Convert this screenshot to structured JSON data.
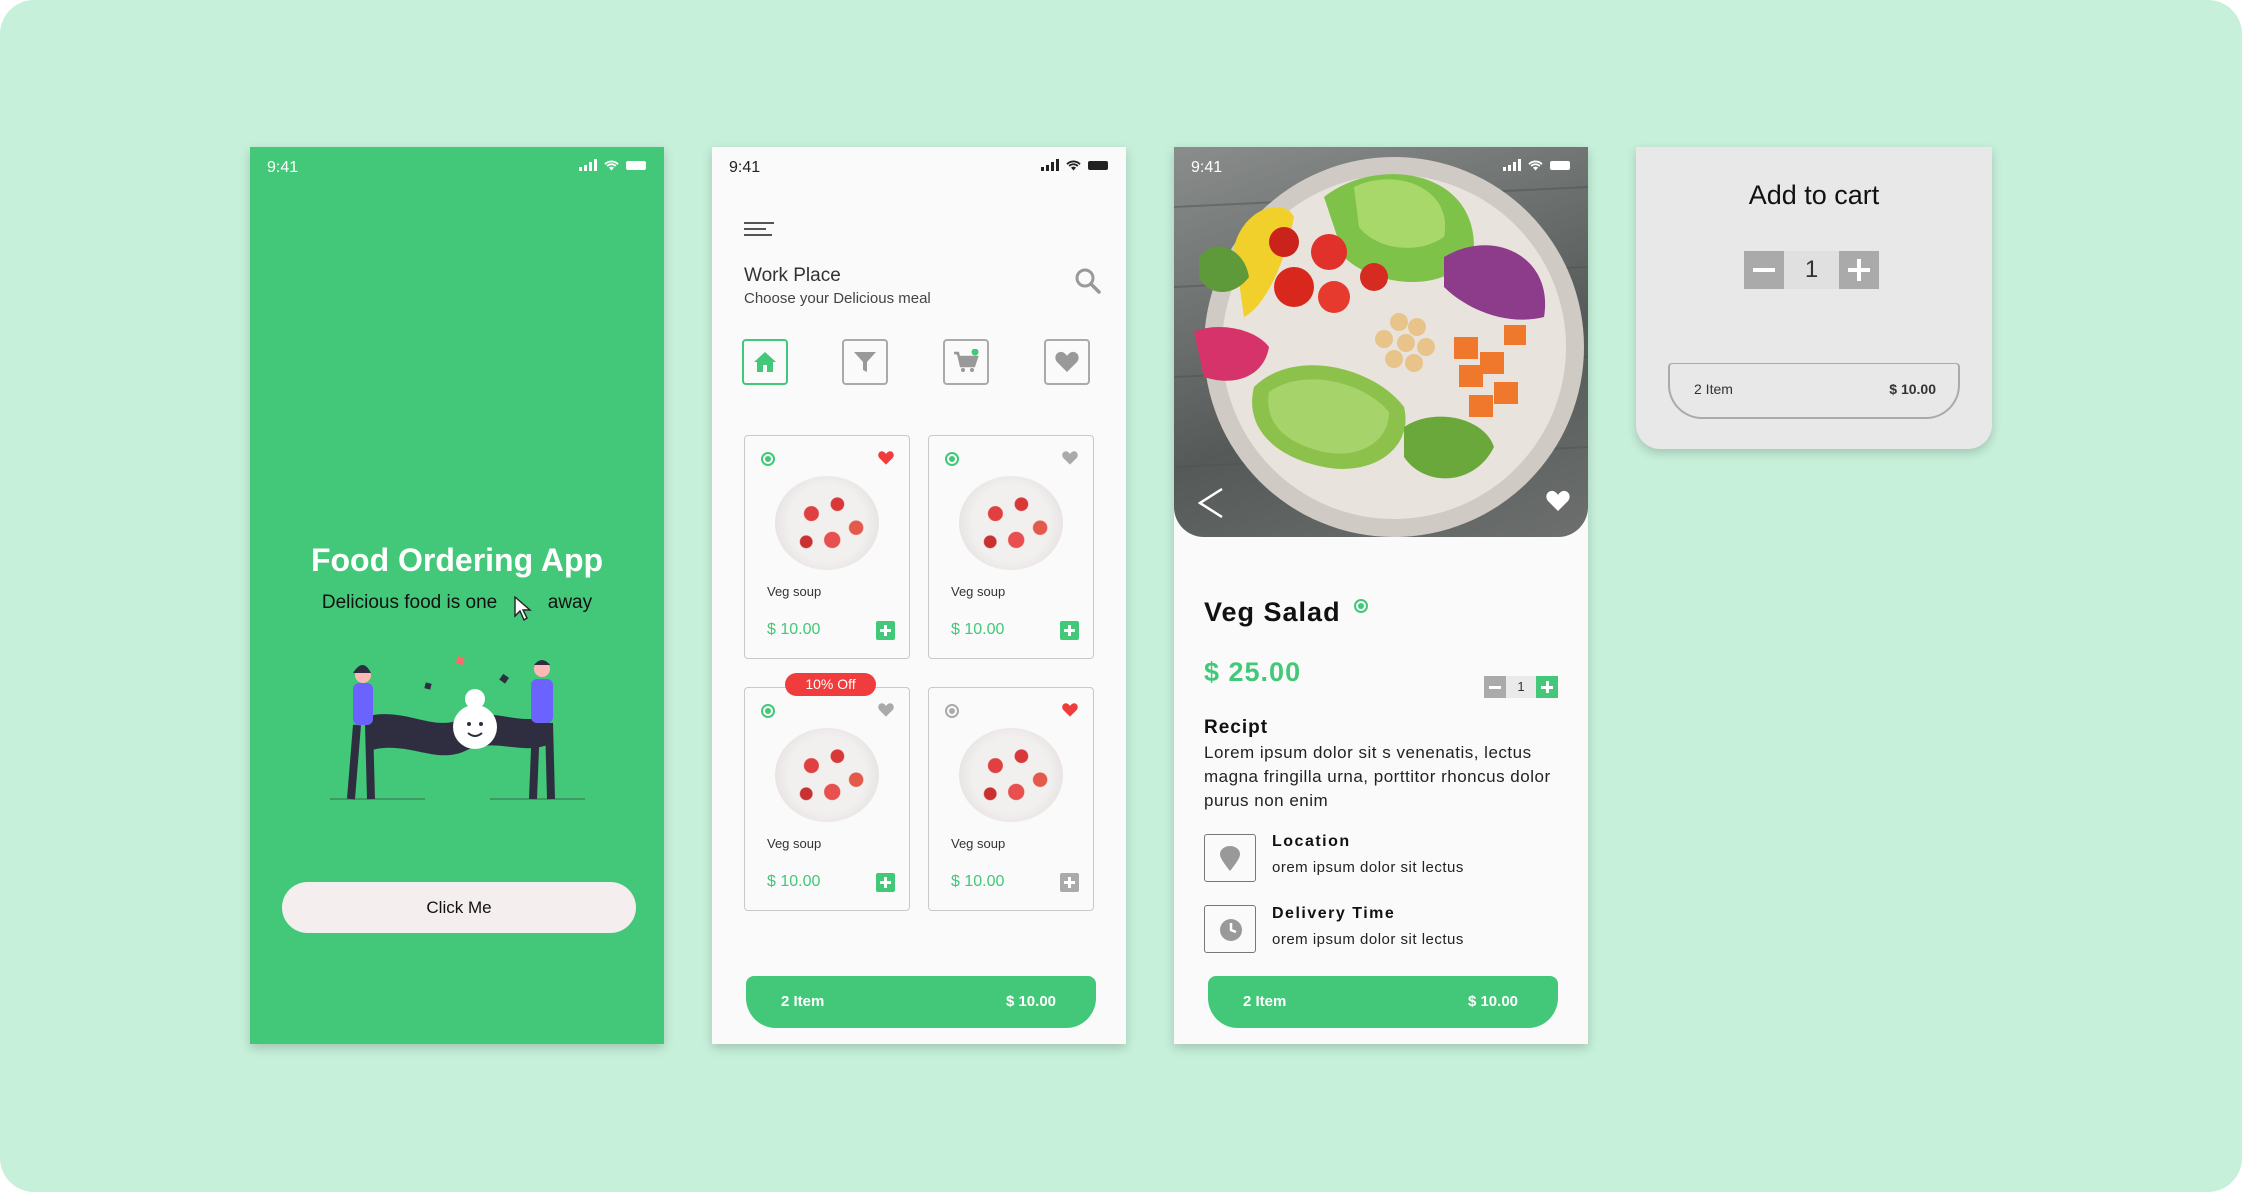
{
  "status": {
    "time": "9:41"
  },
  "onboarding": {
    "title": "Food Ordering App",
    "tagline_start": "Delicious food is one",
    "tagline_end": "away",
    "cta_label": "Click Me"
  },
  "menu": {
    "title": "Work Place",
    "subtitle": "Choose your Delicious meal",
    "tabs": [
      {
        "icon": "home-icon"
      },
      {
        "icon": "filter-icon"
      },
      {
        "icon": "cart-icon"
      },
      {
        "icon": "heart-icon"
      }
    ],
    "items": [
      {
        "name": "Veg soup",
        "price": "$ 10.00",
        "favorite": true
      },
      {
        "name": "Veg soup",
        "price": "$ 10.00",
        "favorite": false
      },
      {
        "name": "Veg soup",
        "price": "$ 10.00",
        "favorite": false,
        "badge": "10% Off"
      },
      {
        "name": "Veg soup",
        "price": "$ 10.00",
        "favorite": true
      }
    ],
    "cart": {
      "count": "2 Item",
      "total": "$ 10.00"
    }
  },
  "detail": {
    "name": "Veg Salad",
    "price": "$ 25.00",
    "quantity": "1",
    "recipe_heading": "Recipt",
    "recipe_text": "Lorem ipsum dolor sit  s venenatis, lectus magna fringilla urna, porttitor rhoncus dolor purus non enim",
    "location_heading": "Location",
    "location_text": "orem ipsum dolor sit lectus",
    "delivery_heading": "Delivery Time",
    "delivery_text": "orem ipsum dolor sit lectus",
    "cart": {
      "count": "2 Item",
      "total": "$ 10.00"
    }
  },
  "add_to_cart": {
    "heading": "Add to cart",
    "quantity": "1",
    "cart": {
      "count": "2 Item",
      "total": "$ 10.00"
    }
  },
  "colors": {
    "background": "#c6f0da",
    "accent": "#42c878",
    "badge": "#f03c3c",
    "muted": "#aaaaaa"
  }
}
